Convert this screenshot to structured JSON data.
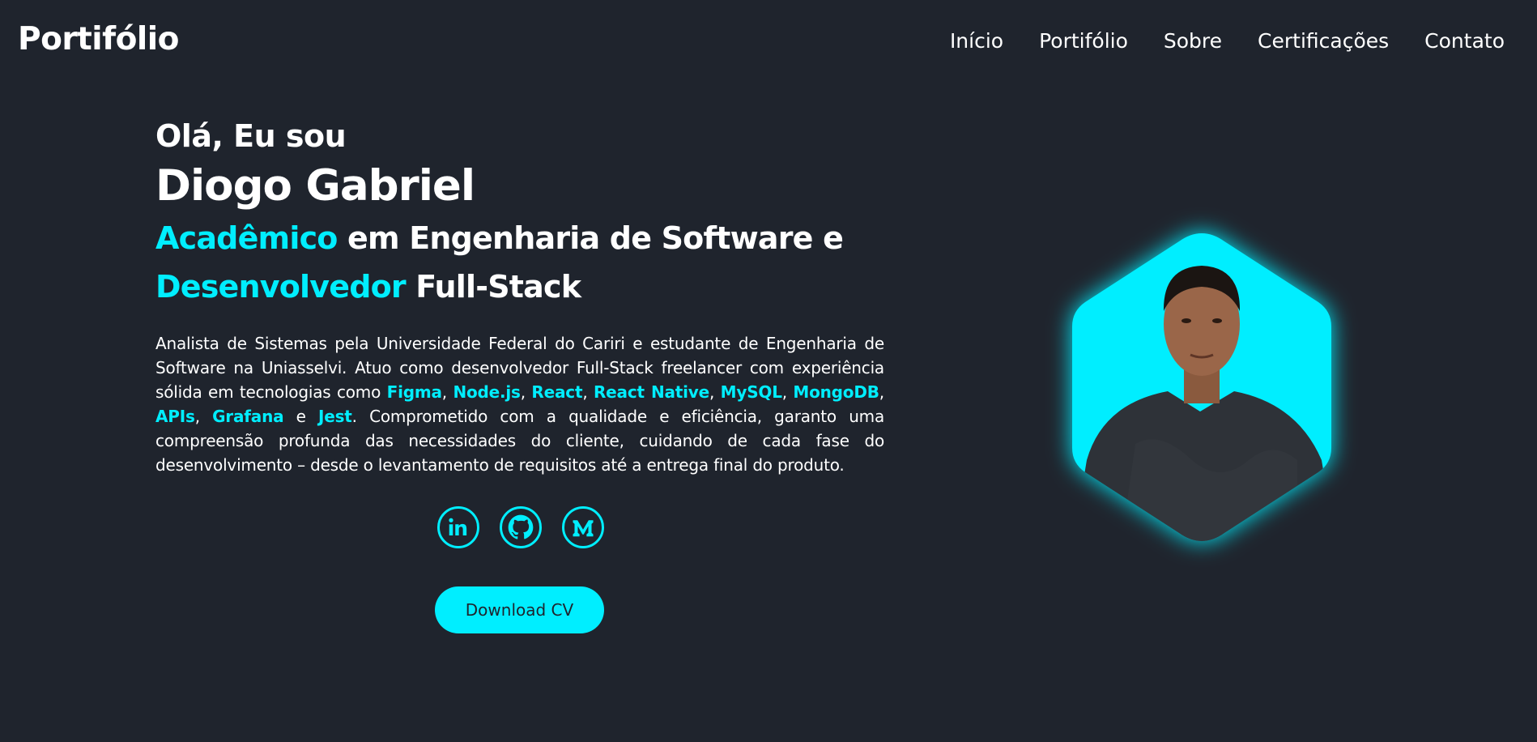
{
  "header": {
    "logo": "Portifólio",
    "nav": [
      "Início",
      "Portifólio",
      "Sobre",
      "Certificações",
      "Contato"
    ]
  },
  "home": {
    "greeting": "Olá, Eu sou",
    "name": "Diogo Gabriel",
    "role_line1_accent": "Acadêmico",
    "role_line1_rest": " em Engenharia de Software e",
    "role_line2_accent": "Desenvolvedor",
    "role_line2_rest": " Full-Stack",
    "about": {
      "p1": "Analista de Sistemas pela Universidade Federal do Cariri e estudante de Engenharia de Software na Uniasselvi. Atuo como desenvolvedor Full-Stack freelancer com experiência sólida em tecnologias como ",
      "techs": [
        "Figma",
        "Node.js",
        "React",
        "React Native",
        "MySQL",
        "MongoDB",
        "APIs",
        "Grafana",
        "Jest"
      ],
      "sep_comma": ", ",
      "sep_and": " e ",
      "p2": ". Comprometido com a qualidade e eficiência, garanto uma compreensão profunda das necessidades do cliente, cuidando de cada fase do desenvolvimento – desde o levantamento de requisitos até a entrega final do produto."
    },
    "social": [
      "linkedin-icon",
      "github-icon",
      "medium-icon"
    ],
    "download_label": "Download CV"
  },
  "colors": {
    "background": "#1f242d",
    "accent": "#00eeff",
    "text": "#ffffff"
  }
}
